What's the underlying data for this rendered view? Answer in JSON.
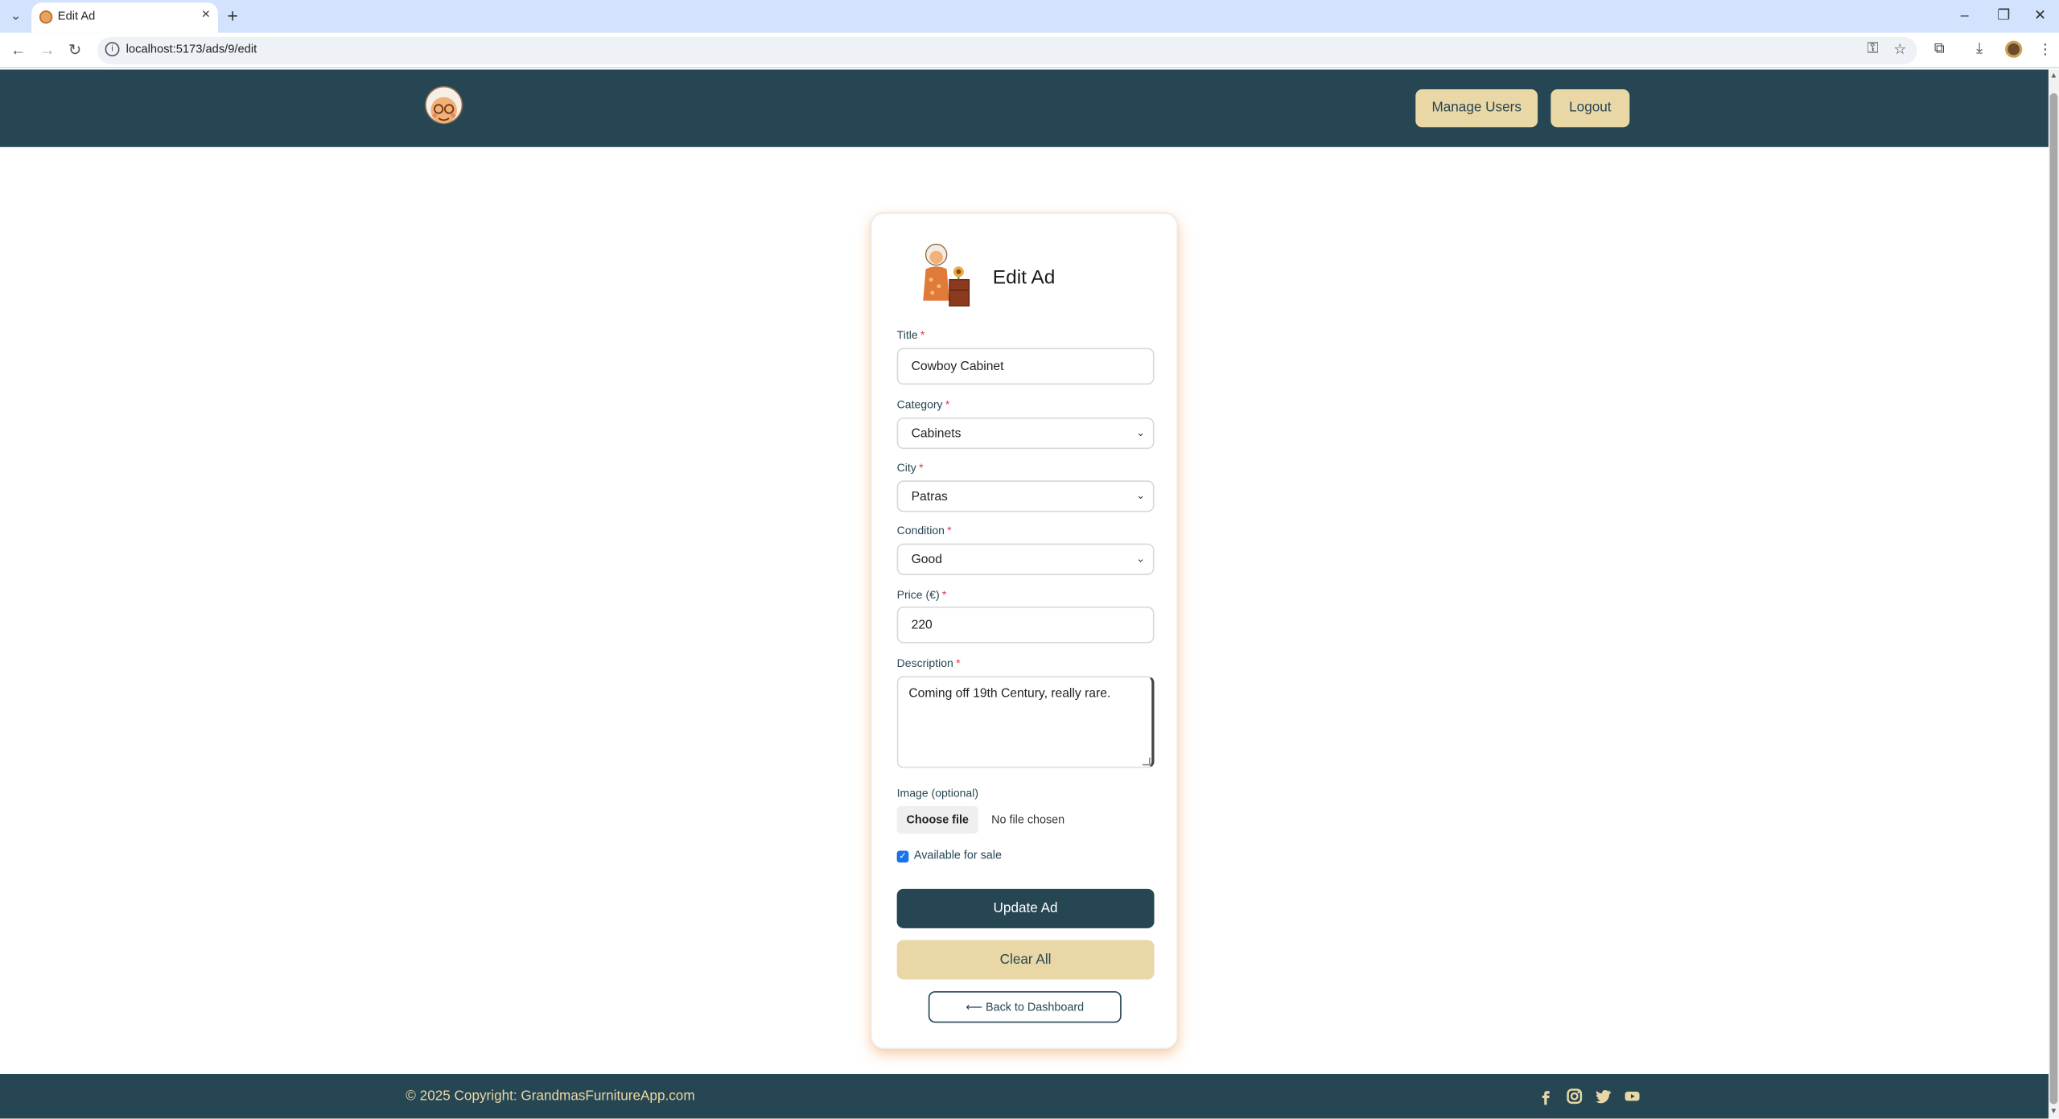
{
  "browser": {
    "tab_title": "Edit Ad",
    "url": "localhost:5173/ads/9/edit",
    "icons": [
      "tab-search-icon",
      "close-icon",
      "new-tab-icon",
      "minimize-icon",
      "restore-icon",
      "window-close-icon",
      "back-icon",
      "forward-icon",
      "reload-icon",
      "site-info-icon",
      "password-key-icon",
      "bookmark-star-icon",
      "extensions-icon",
      "download-icon",
      "profile-avatar",
      "more-menu-icon"
    ]
  },
  "header": {
    "manage_users_label": "Manage Users",
    "logout_label": "Logout"
  },
  "form": {
    "heading": "Edit Ad",
    "title_label": "Title",
    "title_value": "Cowboy Cabinet",
    "category_label": "Category",
    "category_value": "Cabinets",
    "city_label": "City",
    "city_value": "Patras",
    "condition_label": "Condition",
    "condition_value": "Good",
    "price_label": "Price (€)",
    "price_value": "220",
    "description_label": "Description",
    "description_value": "Coming off 19th Century, really rare.",
    "image_label": "Image (optional)",
    "choose_file_label": "Choose file",
    "no_file_text": "No file chosen",
    "available_label": "Available for sale",
    "available_checked": true,
    "required_mark": "*",
    "update_label": "Update Ad",
    "clear_label": "Clear All",
    "back_label": "⟵ Back to Dashboard"
  },
  "footer": {
    "copyright": "© 2025 Copyright: GrandmasFurnitureApp.com",
    "social_icons": [
      "facebook-icon",
      "instagram-icon",
      "twitter-icon",
      "youtube-icon"
    ]
  },
  "colors": {
    "primary": "#264653",
    "accent": "#e9d8a6",
    "shadow": "#f4a261",
    "required": "#e63946"
  }
}
